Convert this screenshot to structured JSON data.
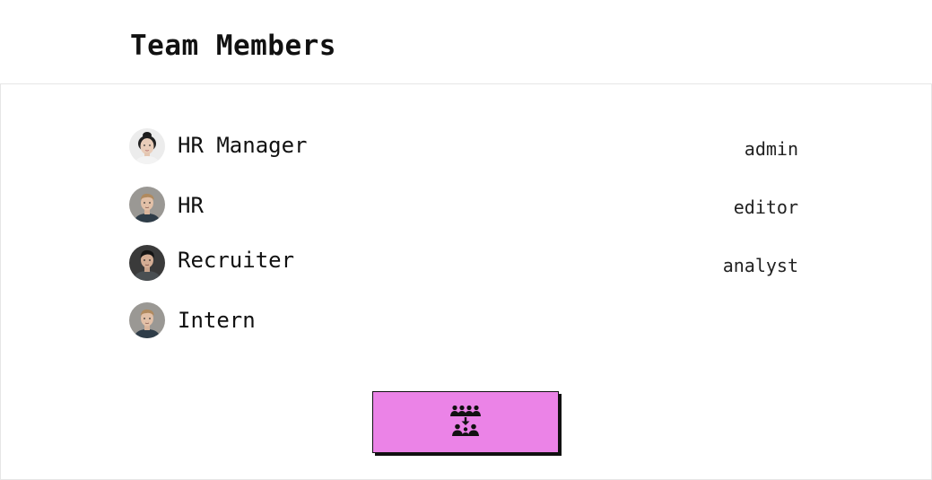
{
  "page": {
    "title": "Team Members"
  },
  "members": [
    {
      "name": "HR Manager",
      "role": "admin",
      "avatar": "female-portrait-avatar"
    },
    {
      "name": "HR",
      "role": "editor",
      "avatar": "male-portrait-avatar"
    },
    {
      "name": "Recruiter",
      "role": "analyst",
      "avatar": "dark-haired-male-avatar"
    },
    {
      "name": "Intern",
      "role": "",
      "avatar": "male-portrait-avatar"
    }
  ],
  "action": {
    "icon": "team-merge-icon",
    "color": "#eb83e7"
  }
}
